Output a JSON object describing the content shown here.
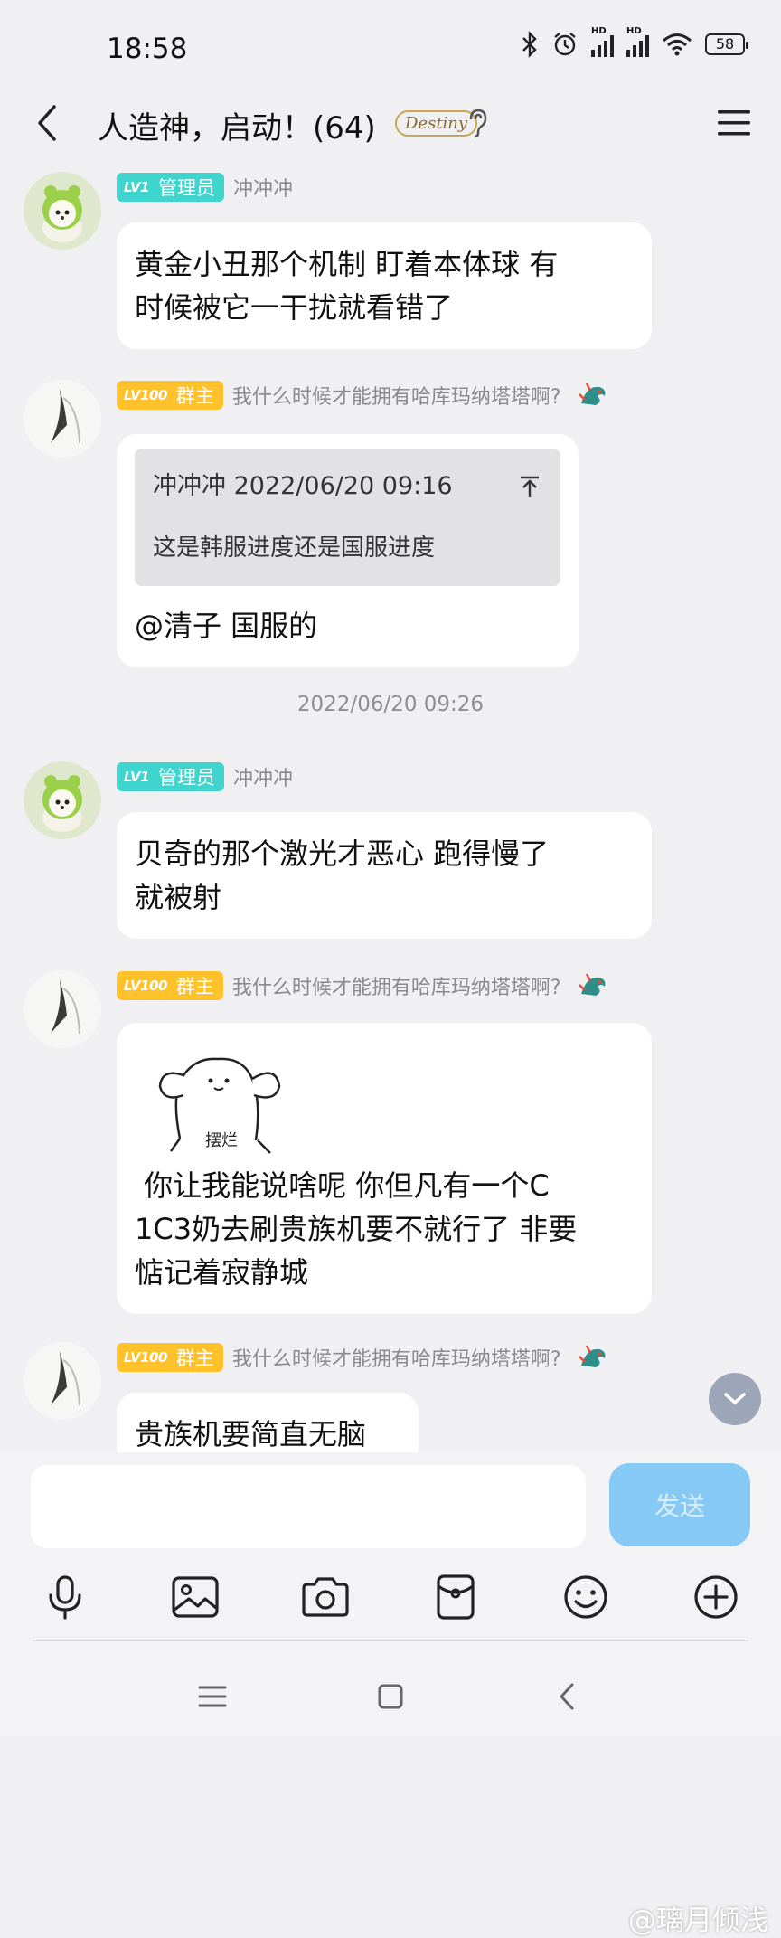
{
  "status_bar": {
    "time": "18:58",
    "battery": "58"
  },
  "header": {
    "title": "人造神，启动！(64)",
    "title_badge": "Destiny"
  },
  "messages": [
    {
      "badge_level": "LV1",
      "badge_role": "管理员",
      "nickname": "冲冲冲",
      "lines": [
        "黄金小丑那个机制 盯着本体球 有",
        "时候被它一干扰就看错了"
      ]
    },
    {
      "badge_level": "LV100",
      "badge_role": "群主",
      "nickname": "我什么时候才能拥有哈库玛纳塔塔啊?",
      "quote_header": "冲冲冲 2022/06/20 09:16",
      "quote_body": "这是韩服进度还是国服进度",
      "lines": [
        "@清子 国服的"
      ]
    },
    {
      "badge_level": "LV1",
      "badge_role": "管理员",
      "nickname": "冲冲冲",
      "lines": [
        "贝奇的那个激光才恶心 跑得慢了",
        "就被射"
      ]
    },
    {
      "badge_level": "LV100",
      "badge_role": "群主",
      "nickname": "我什么时候才能拥有哈库玛纳塔塔啊?",
      "sticker_text": "摆烂",
      "lines": [
        " 你让我能说啥呢 你但凡有一个C",
        "1C3奶去刷贵族机要不就行了 非要",
        "惦记着寂静城"
      ]
    },
    {
      "badge_level": "LV100",
      "badge_role": "群主",
      "nickname": "我什么时候才能拥有哈库玛纳塔塔啊?",
      "lines": [
        "贵族机要简直无脑"
      ]
    }
  ],
  "timestamp_divider": "2022/06/20 09:26",
  "composer": {
    "input_value": "",
    "send_label": "发送"
  },
  "toolbar_icons": [
    "microphone-icon",
    "image-icon",
    "camera-icon",
    "red-packet-icon",
    "emoji-icon",
    "plus-icon"
  ],
  "watermark": "@璃月倾浅",
  "colors": {
    "admin_badge": "#3fd4cd",
    "owner_badge": "#ffc22a",
    "send_button": "#86c9f4",
    "background": "#f0f0f2"
  }
}
